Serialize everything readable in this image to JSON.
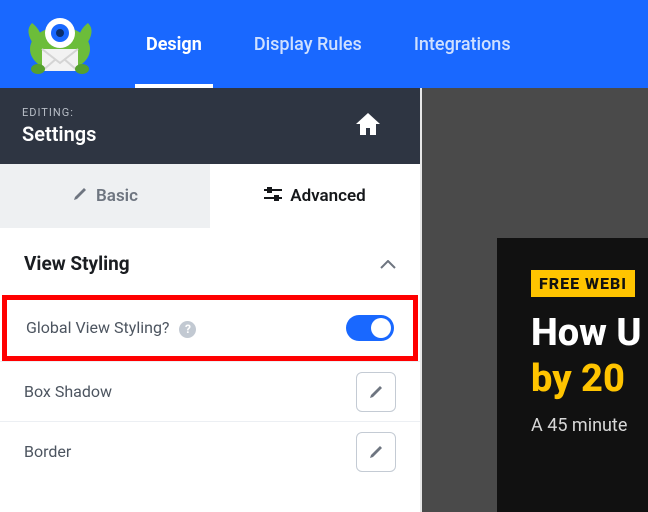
{
  "nav": {
    "tabs": [
      "Design",
      "Display Rules",
      "Integrations"
    ],
    "activeIndex": 0
  },
  "editing": {
    "label": "EDITING:",
    "title": "Settings"
  },
  "subtabs": {
    "basic": "Basic",
    "advanced": "Advanced"
  },
  "sections": {
    "viewStyling": {
      "title": "View Styling",
      "items": {
        "globalViewStyling": {
          "label": "Global View Styling?",
          "toggle": true
        },
        "boxShadow": {
          "label": "Box Shadow"
        },
        "border": {
          "label": "Border"
        }
      }
    }
  },
  "promo": {
    "badge": "FREE WEBI",
    "line1": "How U",
    "line2": "by 20",
    "sub": "A 45 minute"
  },
  "icons": {
    "home": "home-icon",
    "pencil": "pencil-icon",
    "sliders": "sliders-icon",
    "chevronUp": "chevron-up-icon",
    "help": "?"
  }
}
